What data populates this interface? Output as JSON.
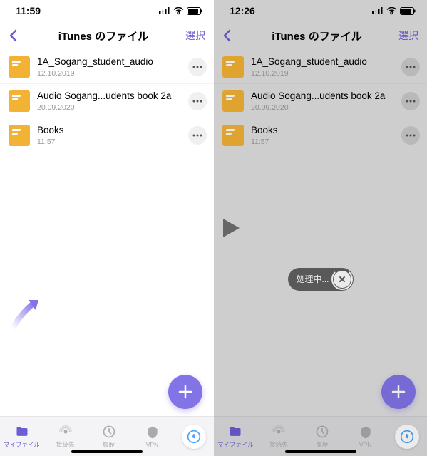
{
  "left": {
    "time": "11:59",
    "title": "iTunes のファイル",
    "select": "選択",
    "files": [
      {
        "name": "1A_Sogang_student_audio",
        "date": "12.10.2019"
      },
      {
        "name": "Audio Sogang...udents book 2a",
        "date": "20.09.2020"
      },
      {
        "name": "Books",
        "date": "11:57"
      }
    ]
  },
  "right": {
    "time": "12:26",
    "title": "iTunes のファイル",
    "select": "選択",
    "files": [
      {
        "name": "1A_Sogang_student_audio",
        "date": "12.10.2019"
      },
      {
        "name": "Audio Sogang...udents book 2a",
        "date": "20.09.2020"
      },
      {
        "name": "Books",
        "date": "11:57"
      }
    ],
    "toast": "処理中..."
  },
  "tabs": {
    "files": "マイファイル",
    "connect": "接続先",
    "history": "履歴",
    "vpn": "VPN"
  }
}
